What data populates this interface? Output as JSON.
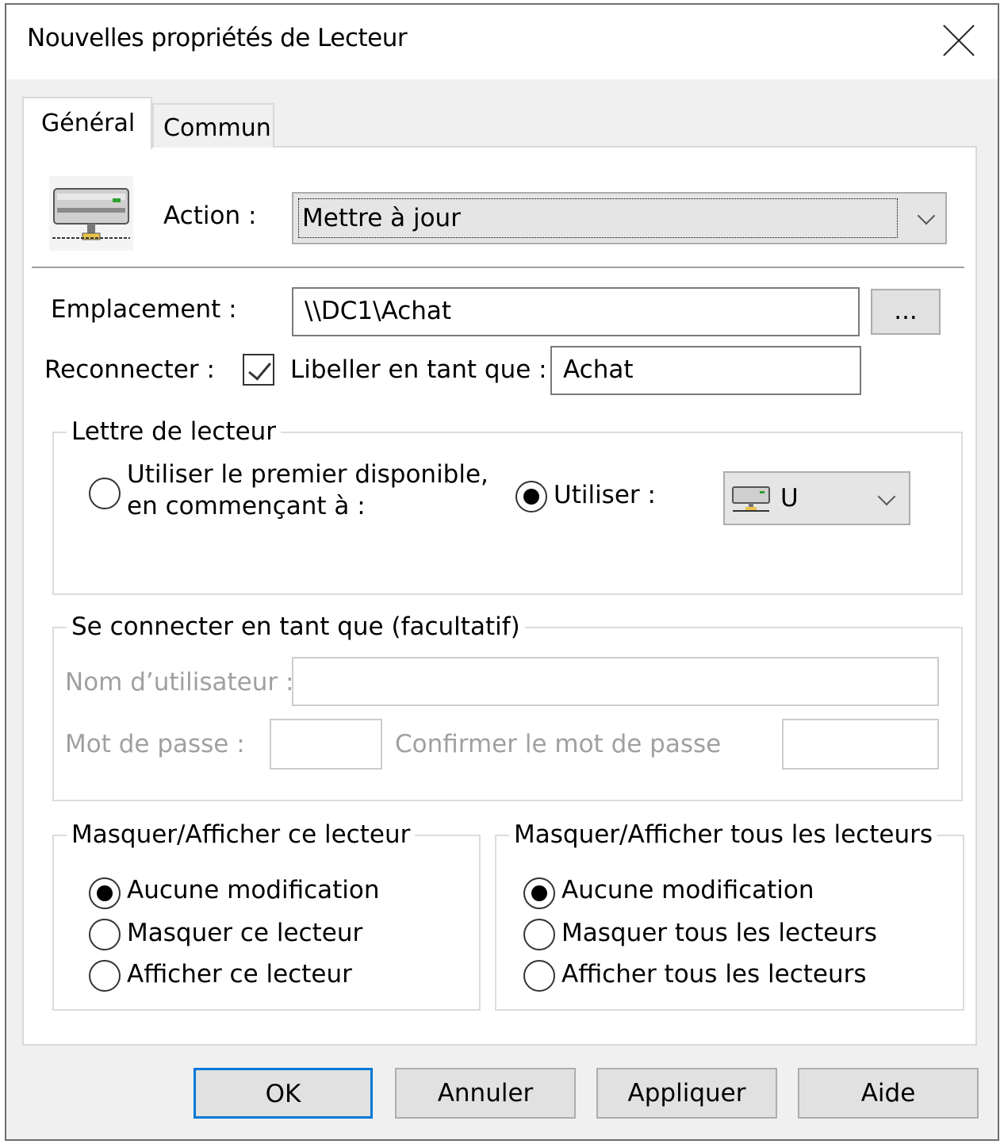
{
  "window": {
    "title": "Nouvelles propriétés de Lecteur"
  },
  "tabs": [
    {
      "label": "Général"
    },
    {
      "label": "Commun"
    }
  ],
  "action": {
    "label": "Action :",
    "value": "Mettre à jour"
  },
  "emplacement": {
    "label": "Emplacement :",
    "value": "\\\\DC1\\Achat",
    "browse_label": "..."
  },
  "reconnecter": {
    "label": "Reconnecter :",
    "checked": true
  },
  "libeller": {
    "label": "Libeller en tant que :",
    "value": "Achat"
  },
  "lettre": {
    "title": "Lettre de lecteur",
    "option_first_line1": "Utiliser le premier disponible,",
    "option_first_line2": "en commençant à :",
    "option_use": "Utiliser :",
    "selected": "use",
    "drive_value": "U"
  },
  "connect": {
    "title": "Se connecter en tant que (facultatif)",
    "username_label": "Nom d’utilisateur :",
    "password_label": "Mot de passe :",
    "confirm_label": "Confirmer le mot de passe"
  },
  "hide_this": {
    "title": "Masquer/Afficher ce lecteur",
    "options": [
      "Aucune modification",
      "Masquer ce lecteur",
      "Afficher ce lecteur"
    ],
    "selected_index": 0
  },
  "hide_all": {
    "title": "Masquer/Afficher tous les lecteurs",
    "options": [
      "Aucune modification",
      "Masquer tous les lecteurs",
      "Afficher tous les lecteurs"
    ],
    "selected_index": 0
  },
  "buttons": {
    "ok": "OK",
    "cancel": "Annuler",
    "apply": "Appliquer",
    "help": "Aide"
  },
  "colors": {
    "focus": "#0078d7",
    "window_bg": "#f0f0f0",
    "disabled_text": "#a0a0a0"
  }
}
